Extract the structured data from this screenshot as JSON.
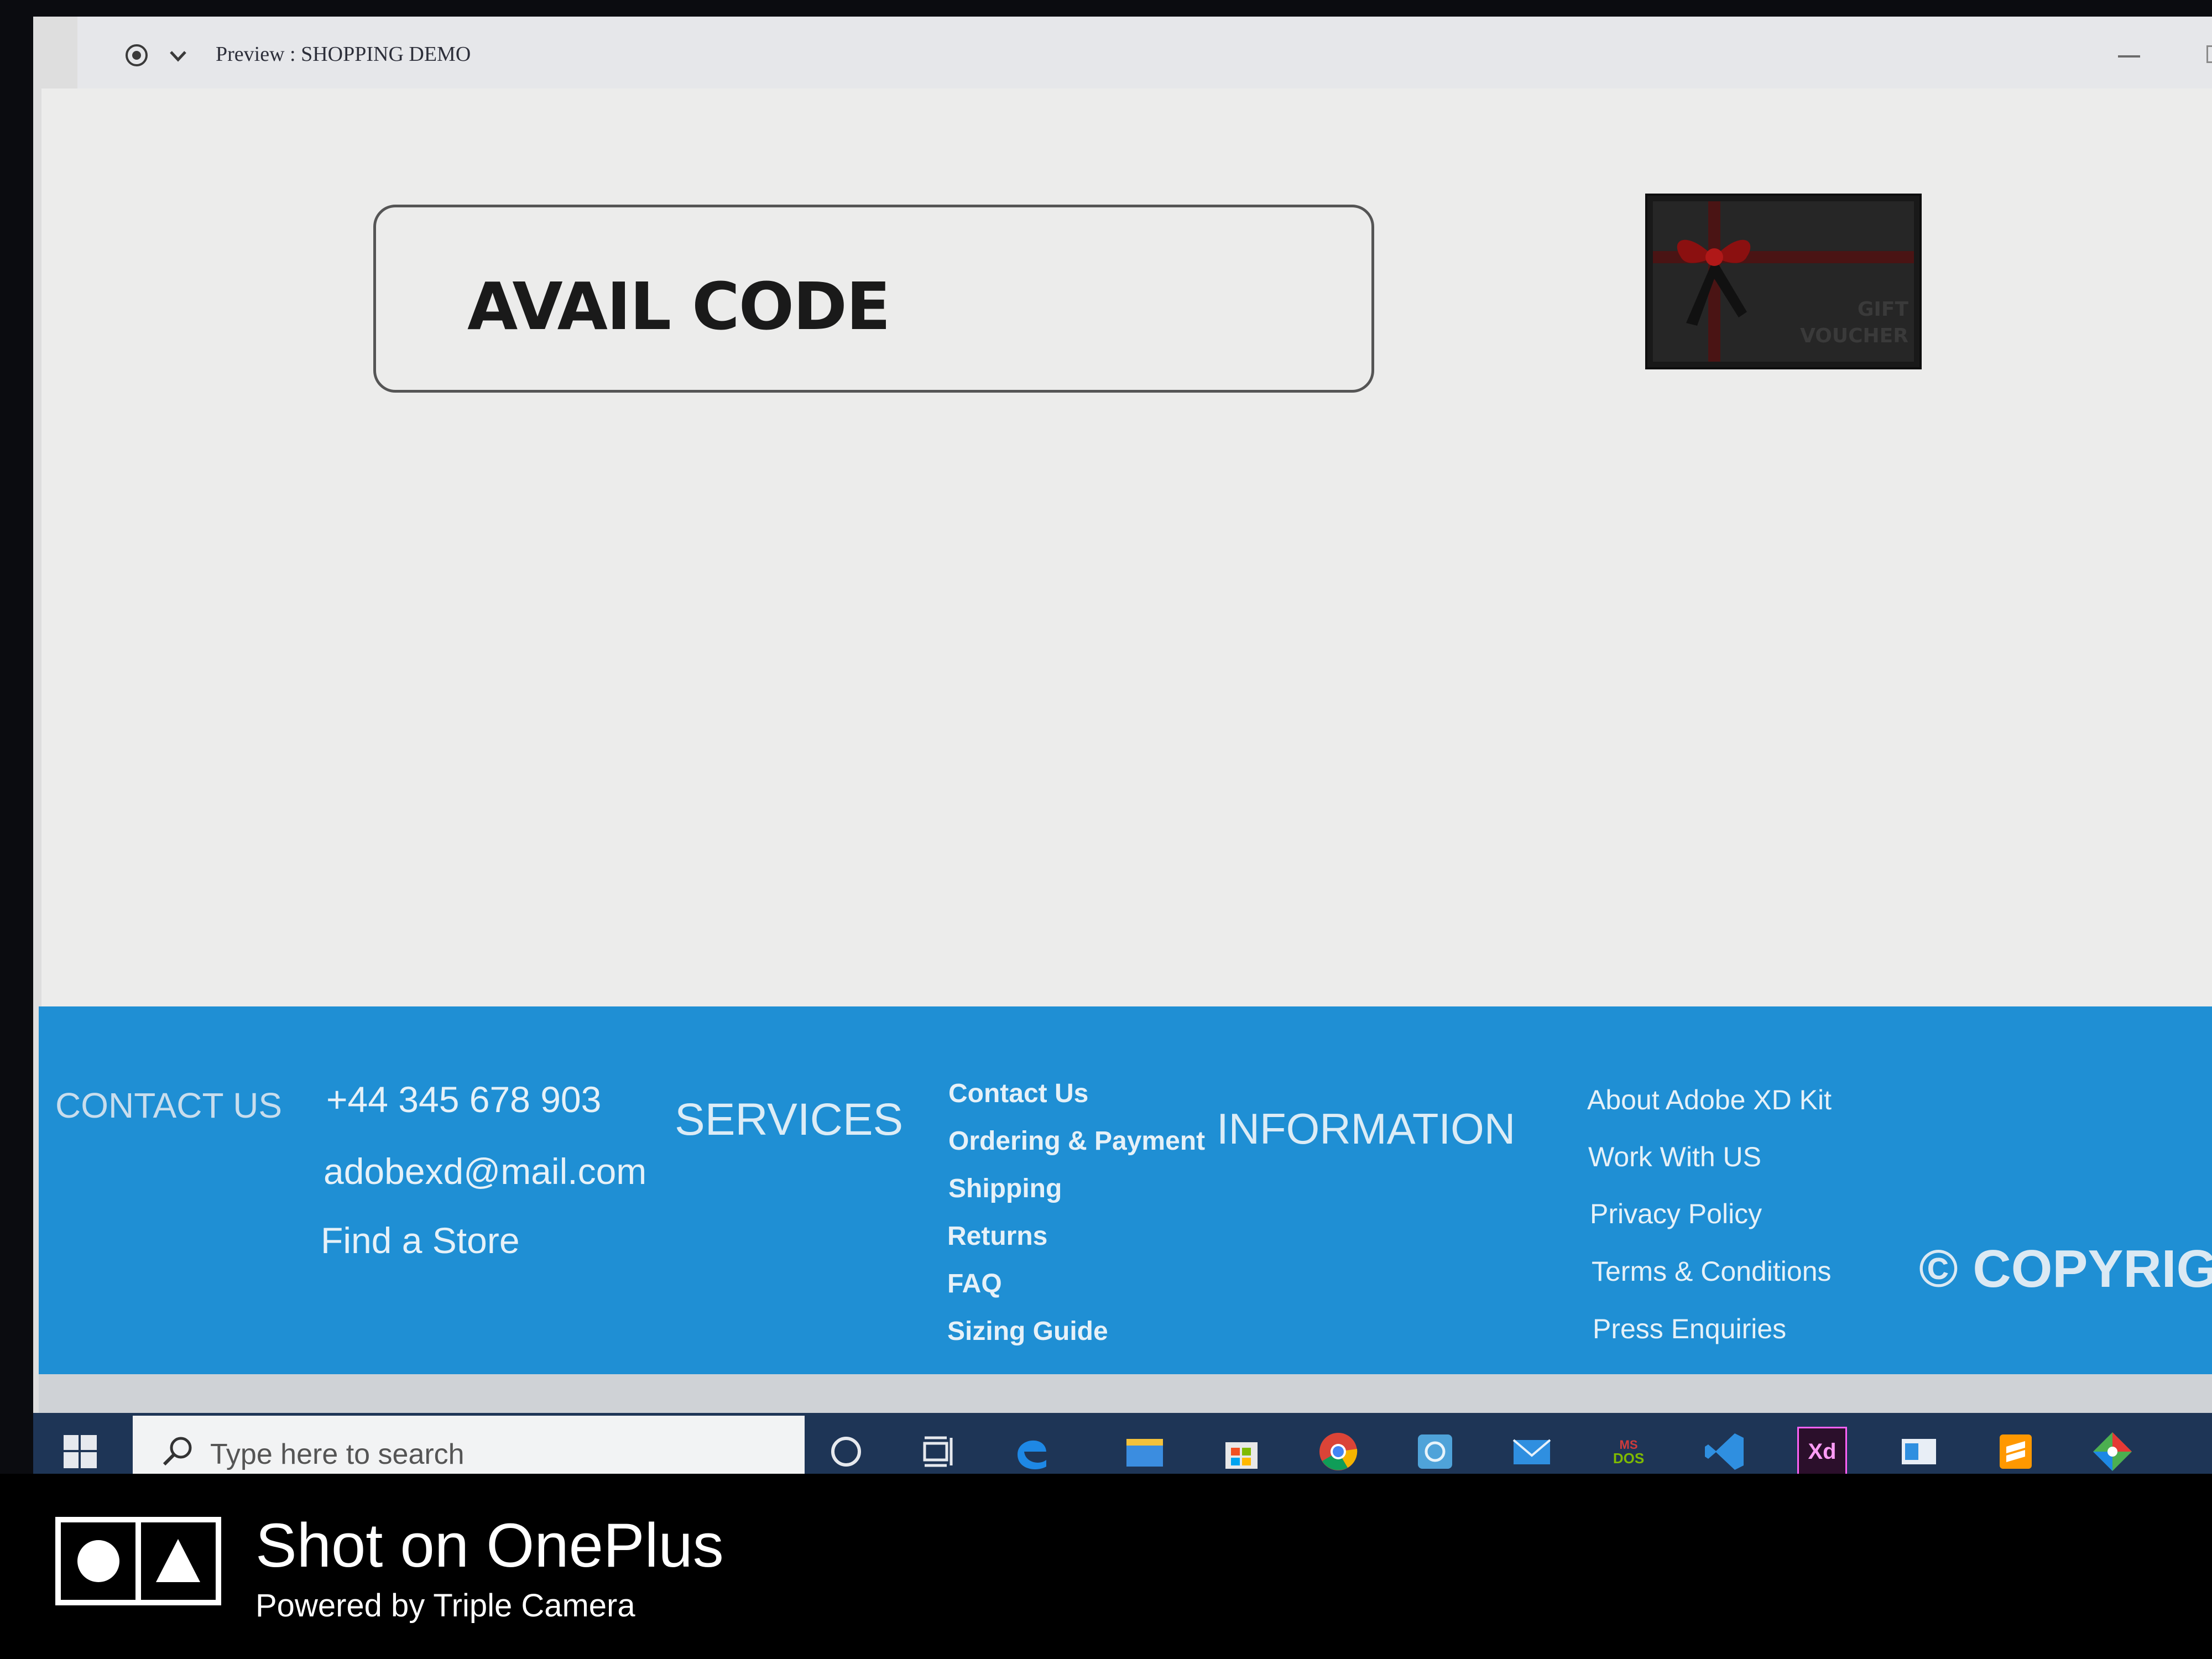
{
  "window": {
    "title": "Preview : SHOPPING DEMO"
  },
  "content": {
    "avail_code_label": "AVAIL CODE",
    "gift_voucher": {
      "line1": "GIFT",
      "line2": "VOUCHER"
    }
  },
  "footer": {
    "contact": {
      "heading": "CONTACT US",
      "phone": "+44 345 678 903",
      "email": "adobexd@mail.com",
      "find_store": "Find a Store"
    },
    "services": {
      "heading": "SERVICES",
      "links": [
        "Contact Us",
        "Ordering & Payment",
        "Shipping",
        "Returns",
        "FAQ",
        "Sizing Guide"
      ]
    },
    "information": {
      "heading": "INFORMATION",
      "links": [
        "About Adobe XD Kit",
        "Work With US",
        "Privacy Policy",
        "Terms & Conditions",
        "Press Enquiries"
      ]
    },
    "copyright": "© COPYRIG"
  },
  "taskbar": {
    "search_placeholder": "Type here to search",
    "icons": [
      "cortana-icon",
      "task-view-icon",
      "edge-icon",
      "file-explorer-icon",
      "store-icon",
      "chrome-icon",
      "app-icon",
      "mail-icon",
      "ms-dos-icon",
      "vscode-icon",
      "adobe-xd-icon",
      "window-app-icon",
      "sublime-text-icon",
      "git-icon"
    ],
    "xd_label": "Xd",
    "msdos_label": "MS DOS"
  },
  "watermark": {
    "title": "Shot on OnePlus",
    "subtitle": "Powered by Triple Camera"
  },
  "colors": {
    "footer_blue": "#1f8fd4",
    "taskbar": "#1e3556",
    "content_bg": "#ececeb"
  }
}
